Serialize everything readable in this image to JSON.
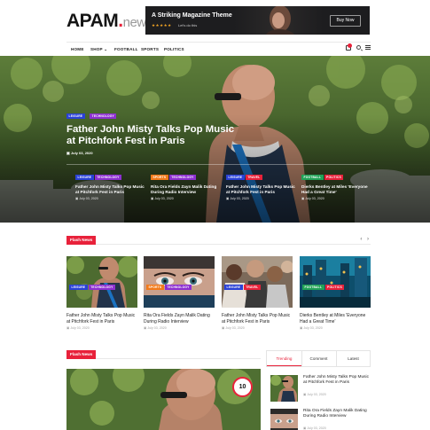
{
  "header": {
    "logo_main": "APAM",
    "logo_dot": ".",
    "logo_suffix": "news",
    "ad": {
      "title": "A Striking Magazine Theme",
      "stars": "★★★★★",
      "subtitle": "Let's do this",
      "button": "Buy Now"
    }
  },
  "nav": {
    "items": [
      "HOME",
      "SHOP",
      "FOOTBALL",
      "SPORTS",
      "POLITICS"
    ],
    "shop_chevron": "⌄"
  },
  "hero": {
    "badges": [
      "LEISURE",
      "TECHNOLOGY"
    ],
    "title": "Father John Misty Talks Pop Music at Pitchfork Fest in Paris",
    "date": "July 03, 2020",
    "minis": [
      {
        "badges": [
          "LEISURE",
          "TECHNOLOGY"
        ],
        "title": "Father John Misty Talks Pop Music at Pitchfork Fest in Paris",
        "date": "July 03, 2020"
      },
      {
        "badges": [
          "SPORTS",
          "TECHNOLOGY"
        ],
        "title": "Rita Ora Fields Zayn Malik Dating During Radio Interview",
        "date": "July 03, 2020"
      },
      {
        "badges": [
          "LEISURE",
          "TRAVEL"
        ],
        "title": "Father John Misty Talks Pop Music at Pitchfork Fest in Paris",
        "date": "July 03, 2020"
      },
      {
        "badges": [
          "FOOTBALL",
          "POLITICS"
        ],
        "title": "Dierks Bentley at Miles 'Everyone Had a Great Time'",
        "date": "July 03, 2020"
      }
    ]
  },
  "flash": {
    "label": "Flash News",
    "arrows": "‹ ›",
    "cards": [
      {
        "badges": [
          "LEISURE",
          "TECHNOLOGY"
        ],
        "title": "Father John Misty Talks Pop Music at Pitchfork Fest in Paris",
        "date": "July 03, 2020"
      },
      {
        "badges": [
          "SPORTS",
          "TECHNOLOGY"
        ],
        "title": "Rita Ora Fields Zayn Malik Dating During Radio Interview",
        "date": "July 03, 2020"
      },
      {
        "badges": [
          "LEISURE",
          "TRAVEL"
        ],
        "title": "Father John Misty Talks Pop Music at Pitchfork Fest in Paris",
        "date": "July 03, 2020"
      },
      {
        "badges": [
          "FOOTBALL",
          "POLITICS"
        ],
        "title": "Dierks Bentley at Miles 'Everyone Had a Great Time'",
        "date": "July 03, 2020"
      }
    ]
  },
  "flash2": {
    "label": "Flash News",
    "number": "10"
  },
  "sidebar": {
    "tabs": [
      "Trending",
      "Comment",
      "Latest"
    ],
    "items": [
      {
        "title": "Father John Misty Talks Pop Music at Pitchfork Fest in Paris",
        "date": "July 03, 2020"
      },
      {
        "title": "Rita Ora Fields Zayn Malik Dating During Radio Interview",
        "date": "July 03, 2020"
      }
    ]
  },
  "colors": {
    "accent": "#e8213a",
    "leisure": "#2a41d6",
    "technology": "#8d2fd0",
    "sports": "#f27a1a",
    "travel": "#e8213a",
    "football": "#21a357",
    "politics": "#e8213a"
  }
}
